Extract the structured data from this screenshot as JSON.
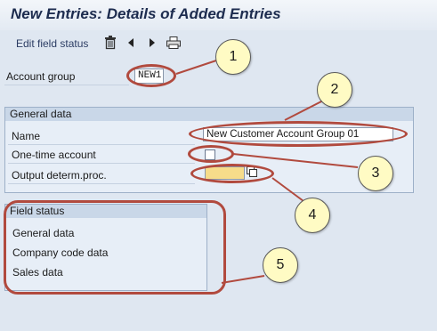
{
  "title": "New Entries: Details of Added Entries",
  "toolbar": {
    "edit_field_status": "Edit field status",
    "icons": [
      "trash-icon",
      "previous-entry-icon",
      "next-entry-icon",
      "print-icon"
    ]
  },
  "account_group": {
    "label": "Account group",
    "value": "NEW1"
  },
  "general_data": {
    "header": "General data",
    "name_label": "Name",
    "name_value": "New Customer Account Group 01",
    "one_time_label": "One-time account",
    "one_time_checked": false,
    "output_label": "Output determ.proc.",
    "output_value": ""
  },
  "field_status": {
    "header": "Field status",
    "items": [
      "General data",
      "Company code data",
      "Sales data"
    ]
  },
  "callouts": [
    "1",
    "2",
    "3",
    "4",
    "5"
  ],
  "colors": {
    "highlight_oval": "#b14a3e",
    "callout_fill": "#fffbc4",
    "required_field": "#f6dc8a"
  }
}
